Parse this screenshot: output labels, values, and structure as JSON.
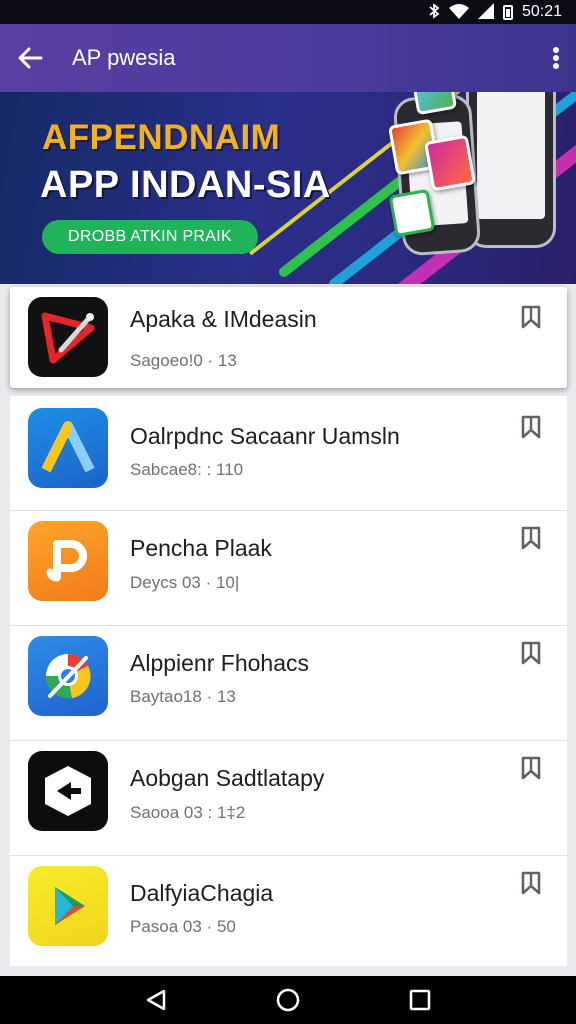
{
  "status_bar": {
    "time": "50:21",
    "icons": [
      "bluetooth-icon",
      "wifi-icon",
      "signal-icon",
      "battery-icon"
    ]
  },
  "app_bar": {
    "title": "AP pwesia",
    "back_icon": "arrow-left-icon",
    "more_icon": "more-vert-icon"
  },
  "banner": {
    "headline": "AFPENDNAIM",
    "subheadline": "APP INDAN-SIA",
    "cta_label": "DROBB ATKIN PRAIK"
  },
  "apps": [
    {
      "name": "Apaka & IMdeasin",
      "meta": "Sagoeo!0 · 13",
      "icon": "red-arrow-app-icon",
      "bookmark_icon": "bookmark-icon"
    },
    {
      "name": "Oalrpdnc Sacaanr Uamsln",
      "meta": "Sabcae8: : 110",
      "icon": "blue-a-app-icon",
      "bookmark_icon": "bookmark-icon"
    },
    {
      "name": "Pencha Plaak",
      "meta": "Deycs 03 · 10|",
      "icon": "orange-p-app-icon",
      "bookmark_icon": "bookmark-icon"
    },
    {
      "name": "Alppienr Fhohacs",
      "meta": "Baytao18 · 13",
      "icon": "browser-app-icon",
      "bookmark_icon": "bookmark-icon"
    },
    {
      "name": "Aobgan Sadtlatapy",
      "meta": "Saooa 03 : 1‡2",
      "icon": "cube-app-icon",
      "bookmark_icon": "bookmark-icon"
    },
    {
      "name": "DalfyiaChagia",
      "meta": "Pasoa 03 · 50",
      "icon": "play-app-icon",
      "bookmark_icon": "bookmark-icon"
    }
  ],
  "nav_bar": {
    "icons": [
      "back-triangle-icon",
      "home-circle-icon",
      "recents-square-icon"
    ]
  },
  "colors": {
    "app_bar": "#4b3a9c",
    "banner_headline": "#f2b21c",
    "cta": "#1fb45a",
    "status_bar": "#0c0c14"
  }
}
